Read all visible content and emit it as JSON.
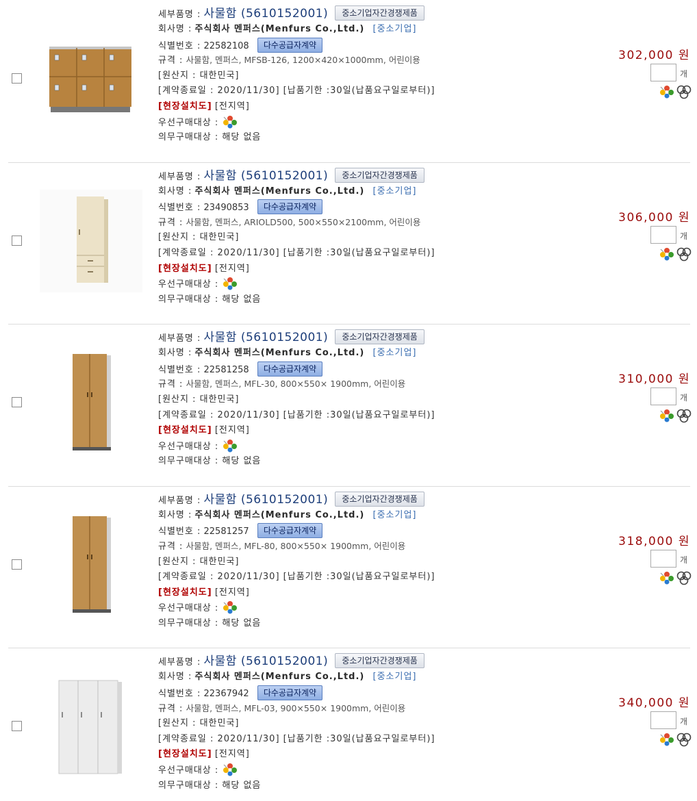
{
  "labels": {
    "detail_name": "세부품명 :",
    "company": "회사명 :",
    "id": "식별번호 :",
    "spec": "규격 :",
    "origin": "[원산지 : 대한민국]",
    "contract_end": "[계약종료일 : 2020/11/30]",
    "delivery": "[납품기한 :30일(납품요구일로부터)]",
    "site": "[현장설치도]",
    "region": "[전지역]",
    "priority": "우선구매대상 :",
    "mandatory": "의무구매대상 : 해당 없음",
    "unit": "개",
    "sme_badge": "중소기업자간경쟁제품",
    "mas_badge": "다수공급자계약"
  },
  "products": [
    {
      "name": "사물함 (5610152001)",
      "company": "주식회사 멘퍼스(Menfurs Co.,Ltd.)",
      "category": "[중소기업]",
      "id": "22582108",
      "spec": "사물함, 멘퍼스, MFSB-126, 1200×420×1000mm, 어린이용",
      "price": "302,000 원",
      "qty": "",
      "image": "locker-6door-wood"
    },
    {
      "name": "사물함 (5610152001)",
      "company": "주식회사 멘퍼스(Menfurs Co.,Ltd.)",
      "category": "[중소기업]",
      "id": "23490853",
      "spec": "사물함, 멘퍼스, ARIOLD500, 500×550×2100mm, 어린이용",
      "price": "306,000 원",
      "qty": "",
      "image": "tall-cabinet-cream"
    },
    {
      "name": "사물함 (5610152001)",
      "company": "주식회사 멘퍼스(Menfurs Co.,Ltd.)",
      "category": "[중소기업]",
      "id": "22581258",
      "spec": "사물함, 멘퍼스, MFL-30, 800×550× 1900mm, 어린이용",
      "price": "310,000 원",
      "qty": "",
      "image": "wardrobe-wood"
    },
    {
      "name": "사물함 (5610152001)",
      "company": "주식회사 멘퍼스(Menfurs Co.,Ltd.)",
      "category": "[중소기업]",
      "id": "22581257",
      "spec": "사물함, 멘퍼스, MFL-80, 800×550× 1900mm, 어린이용",
      "price": "318,000 원",
      "qty": "",
      "image": "wardrobe-wood"
    },
    {
      "name": "사물함 (5610152001)",
      "company": "주식회사 멘퍼스(Menfurs Co.,Ltd.)",
      "category": "[중소기업]",
      "id": "22367942",
      "spec": "사물함, 멘퍼스, MFL-03, 900×550× 1900mm, 어린이용",
      "price": "340,000 원",
      "qty": "",
      "image": "wardrobe-white-3door"
    }
  ],
  "colors": {
    "price": "#9b0c0c",
    "product_name": "#1d3e7a",
    "category": "#3a6db0",
    "site_label": "#b00000"
  }
}
